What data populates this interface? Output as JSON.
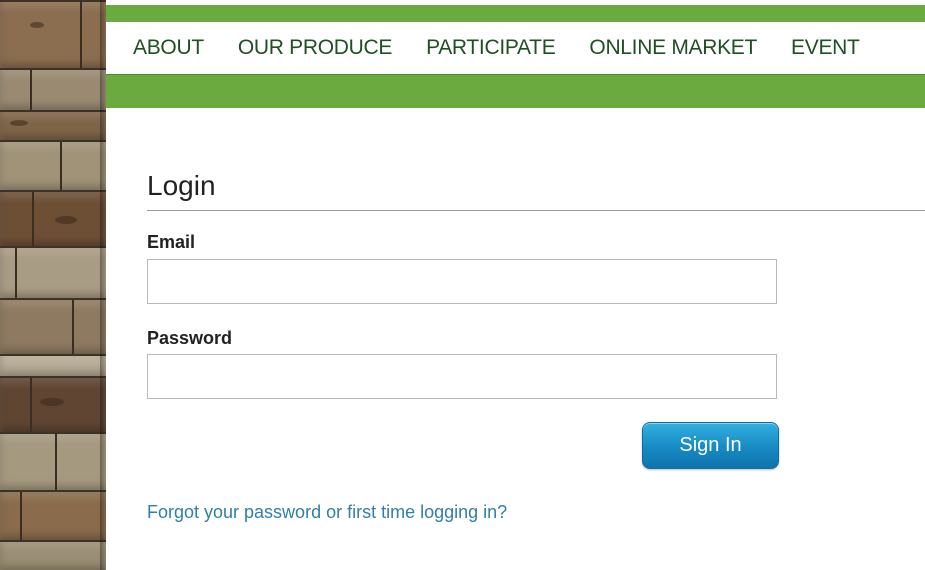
{
  "nav": {
    "items": [
      {
        "label": "ABOUT"
      },
      {
        "label": "OUR PRODUCE"
      },
      {
        "label": "PARTICIPATE"
      },
      {
        "label": "ONLINE MARKET"
      },
      {
        "label": "EVENT"
      }
    ]
  },
  "login": {
    "title": "Login",
    "email_label": "Email",
    "email_value": "",
    "password_label": "Password",
    "password_value": "",
    "sign_in_label": "Sign In",
    "forgot_link": "Forgot your password or first time logging in?"
  },
  "colors": {
    "brand_green": "#6aaa3f",
    "nav_text": "#1f4f22",
    "button_blue": "#1789c4",
    "link_blue": "#2f7fa8"
  }
}
